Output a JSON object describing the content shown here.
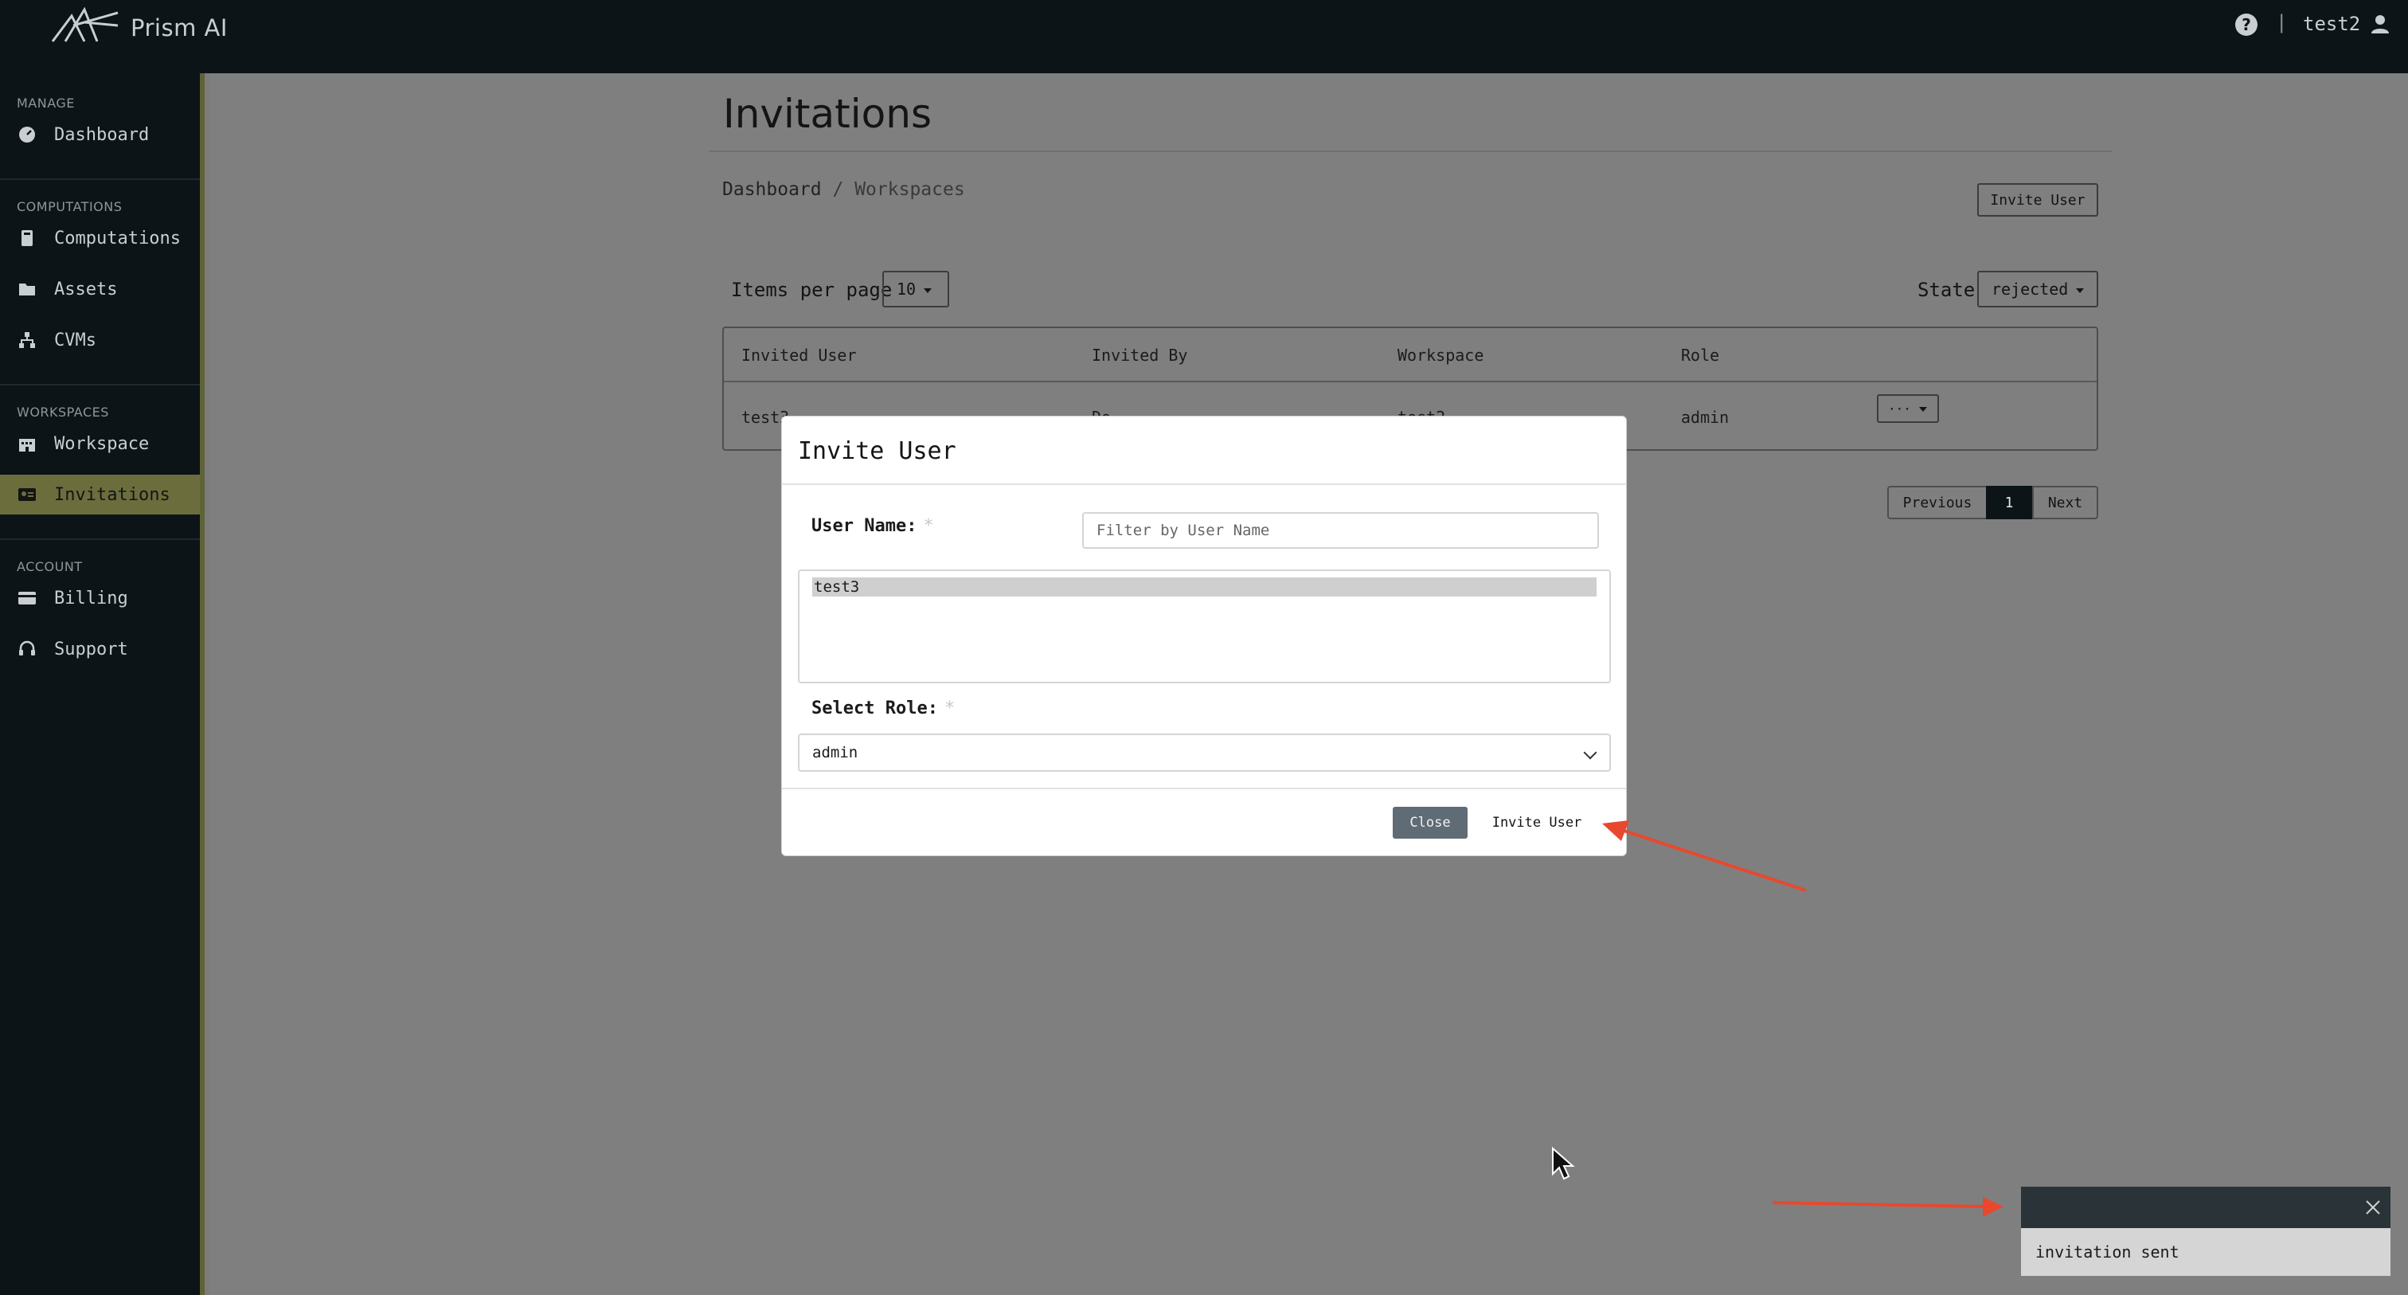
{
  "header": {
    "brand": "Prism AI",
    "user": "test2",
    "separator": "|"
  },
  "sidebar": {
    "sections": [
      {
        "title": "MANAGE"
      },
      {
        "title": "COMPUTATIONS"
      },
      {
        "title": "WORKSPACES"
      },
      {
        "title": "ACCOUNT"
      }
    ],
    "items": [
      {
        "label": "Dashboard",
        "icon": "dashboard-icon"
      },
      {
        "label": "Computations",
        "icon": "computations-icon"
      },
      {
        "label": "Assets",
        "icon": "folder-icon"
      },
      {
        "label": "CVMs",
        "icon": "network-icon"
      },
      {
        "label": "Workspace",
        "icon": "building-icon"
      },
      {
        "label": "Invitations",
        "icon": "id-card-icon",
        "active": true
      },
      {
        "label": "Billing",
        "icon": "credit-card-icon"
      },
      {
        "label": "Support",
        "icon": "headset-icon"
      }
    ]
  },
  "page": {
    "title": "Invitations",
    "breadcrumb": {
      "root": "Dashboard",
      "sep": "/",
      "current": "Workspaces"
    },
    "invite_button": "Invite User",
    "items_per_page_label": "Items per page",
    "items_per_page_value": "10",
    "state_label": "State",
    "state_value": "rejected",
    "table": {
      "columns": [
        "Invited User",
        "Invited By",
        "Workspace",
        "Role"
      ],
      "rows": [
        {
          "invited_user": "test3",
          "invited_by": "Do...",
          "workspace": "test2",
          "role": "admin",
          "action": "···"
        }
      ]
    },
    "pagination": {
      "previous": "Previous",
      "current": "1",
      "next": "Next"
    }
  },
  "modal": {
    "title": "Invite User",
    "user_name_label": "User Name:",
    "required_mark": "*",
    "filter_placeholder": "Filter by User Name",
    "user_options": [
      "test3"
    ],
    "role_label": "Select Role:",
    "role_value": "admin",
    "close_label": "Close",
    "invite_label": "Invite User"
  },
  "toast": {
    "message": "invitation sent"
  },
  "colors": {
    "sidebar_bg": "#0c1418",
    "active_item": "#6b6e3c",
    "annotation_arrow": "#e8482e"
  }
}
